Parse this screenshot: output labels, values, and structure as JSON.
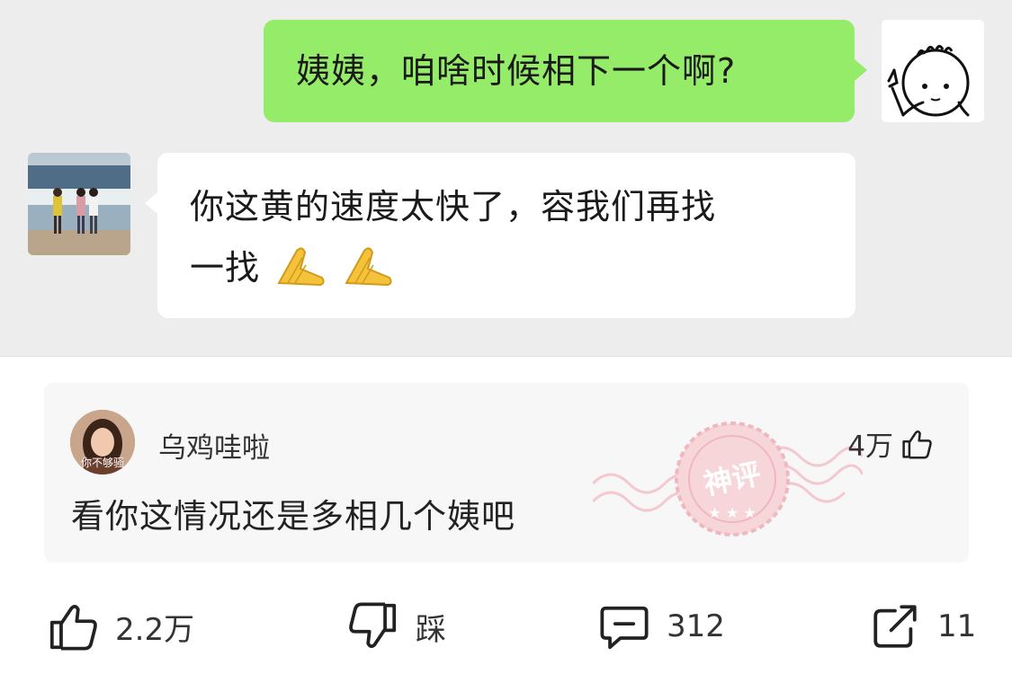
{
  "chat": {
    "messages": [
      {
        "side": "right",
        "sender": "me",
        "text": "姨姨，咱啥时候相下一个啊?"
      },
      {
        "side": "left",
        "sender": "friend",
        "text_line1": "你这黄的速度太快了，容我们再找",
        "text_line2": "一找"
      }
    ],
    "colors": {
      "outgoing": "#95ec69",
      "incoming": "#ffffff",
      "background": "#ededed"
    }
  },
  "comment": {
    "avatar_caption": "你不够骚",
    "username": "乌鸡哇啦",
    "likes": "4万",
    "text": "看你这情况还是多相几个姨吧",
    "badge": "神评"
  },
  "actions": {
    "like": {
      "icon": "thumbs-up-icon",
      "label": "2.2万"
    },
    "dislike": {
      "icon": "thumbs-down-icon",
      "label": "踩"
    },
    "comment": {
      "icon": "comment-icon",
      "label": "312"
    },
    "share": {
      "icon": "share-icon",
      "label": "11"
    }
  }
}
